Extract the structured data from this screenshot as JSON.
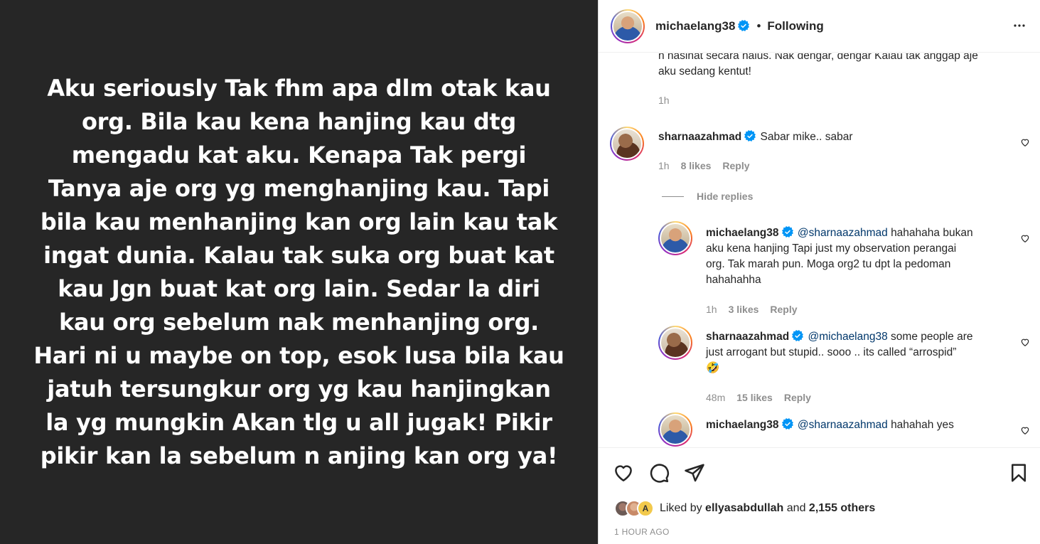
{
  "media": {
    "lines": [
      "Aku seriously Tak fhm apa dlm otak kau",
      "org. Bila kau kena hanjing kau dtg",
      "mengadu kat aku. Kenapa Tak pergi",
      "Tanya aje org yg menghanjing kau. Tapi",
      "bila kau menhanjing kan org lain kau tak",
      "ingat dunia. Kalau tak suka org buat kat",
      "kau Jgn buat kat org lain. Sedar la diri",
      "kau org sebelum nak menhanjing org.",
      "Hari ni u maybe on top, esok lusa bila kau",
      "jatuh tersungkur org yg kau hanjingkan",
      "la yg mungkin Akan tlg u all jugak! Pikir",
      "pikir kan la sebelum n anjing kan org ya!"
    ]
  },
  "header": {
    "username": "michaelang38",
    "dot": "•",
    "follow_status": "Following",
    "more_icon": "more-horizontal-icon"
  },
  "caption": {
    "line1": "n nasihat secara halus. Nak dengar, dengar Kalau tak anggap aje",
    "line2": "aku sedang kentut!",
    "time": "1h"
  },
  "comments": [
    {
      "user": "sharnaazahmad",
      "text": "Sabar mike.. sabar",
      "time": "1h",
      "likes": "8 likes",
      "reply": "Reply"
    }
  ],
  "hide_replies": "Hide replies",
  "replies": [
    {
      "user": "michaelang38",
      "mention": "@sharnaazahmad",
      "text_first": "hahahaha bukan",
      "lines": [
        "aku kena hanjing Tapi just my observation perangai",
        "org. Tak marah pun. Moga org2 tu dpt la pedoman",
        "hahahahha"
      ],
      "time": "1h",
      "likes": "3 likes",
      "reply": "Reply"
    },
    {
      "user": "sharnaazahmad",
      "mention": "@michaelang38",
      "text_first": "some people are",
      "lines": [
        "just arrogant but stupid.. sooo .. its called “arrospid”"
      ],
      "emoji": "🤣",
      "time": "48m",
      "likes": "15 likes",
      "reply": "Reply"
    },
    {
      "user": "michaelang38",
      "mention": "@sharnaazahmad",
      "text_first": "hahahah yes"
    }
  ],
  "footer": {
    "liked_prefix": "Liked by",
    "liked_user": "ellyasabdullah",
    "liked_and": "and",
    "liked_others": "2,155 others",
    "time_ago": "1 HOUR AGO"
  },
  "colors": {
    "media_bg": "#262626",
    "verified": "#0095f6",
    "mention": "#00376b",
    "muted": "#8e8e8e"
  }
}
